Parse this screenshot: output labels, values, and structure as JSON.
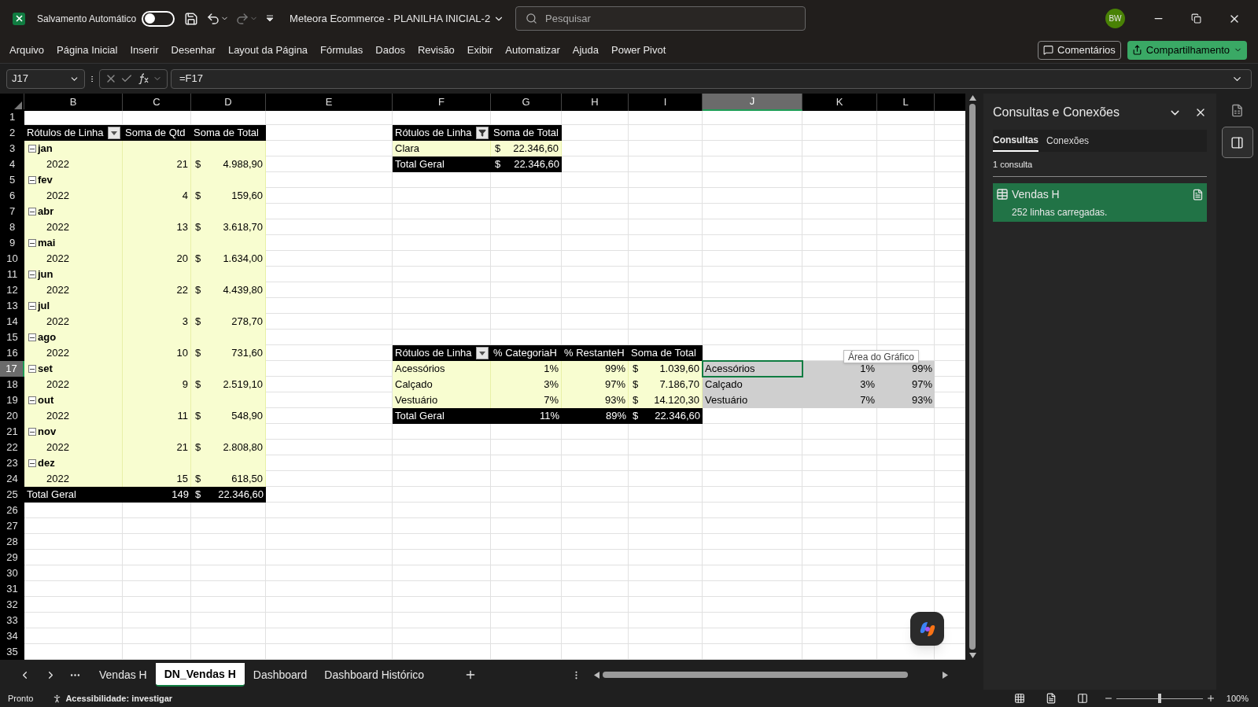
{
  "title_bar": {
    "autosave_label": "Salvamento Automático",
    "autosave_on": false,
    "document_title": "Meteora Ecommerce - PLANILHA INICIAL-2",
    "search_placeholder": "Pesquisar",
    "avatar": "BW"
  },
  "menu": {
    "items": [
      "Arquivo",
      "Página Inicial",
      "Inserir",
      "Desenhar",
      "Layout da Página",
      "Fórmulas",
      "Dados",
      "Revisão",
      "Exibir",
      "Automatizar",
      "Ajuda",
      "Power Pivot"
    ],
    "comments_button": "Comentários",
    "share_button": "Compartilhamento"
  },
  "formula_bar": {
    "name_box": "J17",
    "formula": "=F17"
  },
  "columns": [
    {
      "letter": "B",
      "selected": false
    },
    {
      "letter": "C",
      "selected": false
    },
    {
      "letter": "D",
      "selected": false
    },
    {
      "letter": "E",
      "selected": false
    },
    {
      "letter": "F",
      "selected": false
    },
    {
      "letter": "G",
      "selected": false
    },
    {
      "letter": "H",
      "selected": false
    },
    {
      "letter": "I",
      "selected": false
    },
    {
      "letter": "J",
      "selected": true
    },
    {
      "letter": "K",
      "selected": false
    },
    {
      "letter": "L",
      "selected": false
    }
  ],
  "rows": [
    {
      "number": "1",
      "selected": false,
      "cells": []
    },
    {
      "number": "2",
      "selected": false,
      "cells": [
        {
          "kind": "header",
          "text": "Rótulos de Linha",
          "filtered": false
        },
        {
          "kind": "header",
          "text": "Soma de Qtd"
        },
        {
          "kind": "header",
          "text": "Soma de Total"
        },
        {
          "kind": "blank"
        },
        {
          "kind": "header",
          "text": "Rótulos de Linha",
          "filtered": true
        },
        {
          "kind": "header",
          "text": "Soma de Total"
        }
      ]
    },
    {
      "number": "3",
      "selected": false,
      "cells": [
        {
          "kind": "group",
          "text": "jan",
          "expanded": true
        },
        {
          "kind": "band"
        },
        {
          "kind": "band"
        },
        {
          "kind": "blank"
        },
        {
          "kind": "band",
          "text": "Clara"
        },
        {
          "kind": "band",
          "currency": "$",
          "text": "22.346,60"
        }
      ]
    },
    {
      "number": "4",
      "selected": false,
      "cells": [
        {
          "kind": "item",
          "text": "2022"
        },
        {
          "kind": "value",
          "text": "21"
        },
        {
          "kind": "band",
          "currency": "$",
          "text": "4.988,90"
        },
        {
          "kind": "blank"
        },
        {
          "kind": "total",
          "text": "Total Geral"
        },
        {
          "kind": "total",
          "currency": "$",
          "text": "22.346,60"
        }
      ]
    },
    {
      "number": "5",
      "selected": false,
      "cells": [
        {
          "kind": "group",
          "text": "fev",
          "expanded": true
        },
        {
          "kind": "band"
        },
        {
          "kind": "band"
        }
      ]
    },
    {
      "number": "6",
      "selected": false,
      "cells": [
        {
          "kind": "item",
          "text": "2022"
        },
        {
          "kind": "value",
          "text": "4"
        },
        {
          "kind": "band",
          "currency": "$",
          "text": "159,60"
        }
      ]
    },
    {
      "number": "7",
      "selected": false,
      "cells": [
        {
          "kind": "group",
          "text": "abr",
          "expanded": true
        },
        {
          "kind": "band"
        },
        {
          "kind": "band"
        }
      ]
    },
    {
      "number": "8",
      "selected": false,
      "cells": [
        {
          "kind": "item",
          "text": "2022"
        },
        {
          "kind": "value",
          "text": "13"
        },
        {
          "kind": "band",
          "currency": "$",
          "text": "3.618,70"
        }
      ]
    },
    {
      "number": "9",
      "selected": false,
      "cells": [
        {
          "kind": "group",
          "text": "mai",
          "expanded": true
        },
        {
          "kind": "band"
        },
        {
          "kind": "band"
        }
      ]
    },
    {
      "number": "10",
      "selected": false,
      "cells": [
        {
          "kind": "item",
          "text": "2022"
        },
        {
          "kind": "value",
          "text": "20"
        },
        {
          "kind": "band",
          "currency": "$",
          "text": "1.634,00"
        }
      ]
    },
    {
      "number": "11",
      "selected": false,
      "cells": [
        {
          "kind": "group",
          "text": "jun",
          "expanded": true
        },
        {
          "kind": "band"
        },
        {
          "kind": "band"
        }
      ]
    },
    {
      "number": "12",
      "selected": false,
      "cells": [
        {
          "kind": "item",
          "text": "2022"
        },
        {
          "kind": "value",
          "text": "22"
        },
        {
          "kind": "band",
          "currency": "$",
          "text": "4.439,80"
        }
      ]
    },
    {
      "number": "13",
      "selected": false,
      "cells": [
        {
          "kind": "group",
          "text": "jul",
          "expanded": true
        },
        {
          "kind": "band"
        },
        {
          "kind": "band"
        }
      ]
    },
    {
      "number": "14",
      "selected": false,
      "cells": [
        {
          "kind": "item",
          "text": "2022"
        },
        {
          "kind": "value",
          "text": "3"
        },
        {
          "kind": "band",
          "currency": "$",
          "text": "278,70"
        }
      ]
    },
    {
      "number": "15",
      "selected": false,
      "cells": [
        {
          "kind": "group",
          "text": "ago",
          "expanded": true
        },
        {
          "kind": "band"
        },
        {
          "kind": "band"
        }
      ]
    },
    {
      "number": "16",
      "selected": false,
      "cells": [
        {
          "kind": "item",
          "text": "2022"
        },
        {
          "kind": "value",
          "text": "10"
        },
        {
          "kind": "band",
          "currency": "$",
          "text": "731,60"
        },
        {
          "kind": "blank"
        },
        {
          "kind": "header",
          "text": "Rótulos de Linha",
          "filtered": false
        },
        {
          "kind": "header",
          "text": "% CategoriaH"
        },
        {
          "kind": "header",
          "text": "% RestanteH"
        },
        {
          "kind": "header",
          "text": "Soma de Total"
        }
      ]
    },
    {
      "number": "17",
      "selected": true,
      "cells": [
        {
          "kind": "group",
          "text": "set",
          "expanded": true
        },
        {
          "kind": "band"
        },
        {
          "kind": "band"
        },
        {
          "kind": "blank"
        },
        {
          "kind": "band",
          "text": "Acessórios"
        },
        {
          "kind": "value",
          "text": "1%"
        },
        {
          "kind": "value",
          "text": "99%"
        },
        {
          "kind": "band",
          "currency": "$",
          "text": "1.039,60"
        },
        {
          "kind": "chart",
          "text": "Acessórios"
        },
        {
          "kind": "chart_value",
          "text": "1%"
        },
        {
          "kind": "chart_value",
          "text": "99%"
        }
      ]
    },
    {
      "number": "18",
      "selected": false,
      "cells": [
        {
          "kind": "item",
          "text": "2022"
        },
        {
          "kind": "value",
          "text": "9"
        },
        {
          "kind": "band",
          "currency": "$",
          "text": "2.519,10"
        },
        {
          "kind": "blank"
        },
        {
          "kind": "band",
          "text": "Calçado"
        },
        {
          "kind": "value",
          "text": "3%"
        },
        {
          "kind": "value",
          "text": "97%"
        },
        {
          "kind": "band",
          "currency": "$",
          "text": "7.186,70"
        },
        {
          "kind": "chart",
          "text": "Calçado"
        },
        {
          "kind": "chart_value",
          "text": "3%"
        },
        {
          "kind": "chart_value",
          "text": "97%"
        }
      ]
    },
    {
      "number": "19",
      "selected": false,
      "cells": [
        {
          "kind": "group",
          "text": "out",
          "expanded": true
        },
        {
          "kind": "band"
        },
        {
          "kind": "band"
        },
        {
          "kind": "blank"
        },
        {
          "kind": "band",
          "text": "Vestuário"
        },
        {
          "kind": "value",
          "text": "7%"
        },
        {
          "kind": "value",
          "text": "93%"
        },
        {
          "kind": "band",
          "currency": "$",
          "text": "14.120,30"
        },
        {
          "kind": "chart",
          "text": "Vestuário"
        },
        {
          "kind": "chart_value",
          "text": "7%"
        },
        {
          "kind": "chart_value",
          "text": "93%"
        }
      ]
    },
    {
      "number": "20",
      "selected": false,
      "cells": [
        {
          "kind": "item",
          "text": "2022"
        },
        {
          "kind": "value",
          "text": "11"
        },
        {
          "kind": "band",
          "currency": "$",
          "text": "548,90"
        },
        {
          "kind": "blank"
        },
        {
          "kind": "total",
          "text": "Total Geral"
        },
        {
          "kind": "total_value",
          "text": "11%"
        },
        {
          "kind": "total_value",
          "text": "89%"
        },
        {
          "kind": "total",
          "currency": "$",
          "text": "22.346,60"
        }
      ]
    },
    {
      "number": "21",
      "selected": false,
      "cells": [
        {
          "kind": "group",
          "text": "nov",
          "expanded": true
        },
        {
          "kind": "band"
        },
        {
          "kind": "band"
        }
      ]
    },
    {
      "number": "22",
      "selected": false,
      "cells": [
        {
          "kind": "item",
          "text": "2022"
        },
        {
          "kind": "value",
          "text": "21"
        },
        {
          "kind": "band",
          "currency": "$",
          "text": "2.808,80"
        }
      ]
    },
    {
      "number": "23",
      "selected": false,
      "cells": [
        {
          "kind": "group",
          "text": "dez",
          "expanded": true
        },
        {
          "kind": "band"
        },
        {
          "kind": "band"
        }
      ]
    },
    {
      "number": "24",
      "selected": false,
      "cells": [
        {
          "kind": "item",
          "text": "2022"
        },
        {
          "kind": "value",
          "text": "15"
        },
        {
          "kind": "band",
          "currency": "$",
          "text": "618,50"
        }
      ]
    },
    {
      "number": "25",
      "selected": false,
      "cells": [
        {
          "kind": "total",
          "text": "Total Geral"
        },
        {
          "kind": "total_value",
          "text": "149"
        },
        {
          "kind": "total",
          "currency": "$",
          "text": "22.346,60"
        }
      ]
    },
    {
      "number": "26",
      "selected": false,
      "cells": []
    },
    {
      "number": "27",
      "selected": false,
      "cells": []
    },
    {
      "number": "28",
      "selected": false,
      "cells": []
    },
    {
      "number": "29",
      "selected": false,
      "cells": []
    },
    {
      "number": "30",
      "selected": false,
      "cells": []
    },
    {
      "number": "31",
      "selected": false,
      "cells": []
    },
    {
      "number": "32",
      "selected": false,
      "cells": []
    },
    {
      "number": "33",
      "selected": false,
      "cells": []
    },
    {
      "number": "34",
      "selected": false,
      "cells": []
    },
    {
      "number": "35",
      "selected": false,
      "cells": []
    }
  ],
  "tooltip": "Área do Gráfico",
  "sheet_tabs": [
    {
      "label": "Vendas H",
      "selected": false
    },
    {
      "label": "DN_Vendas H",
      "selected": true
    },
    {
      "label": "Dashboard",
      "selected": false
    },
    {
      "label": "Dashboard Histórico",
      "selected": false
    }
  ],
  "panel": {
    "title": "Consultas e Conexões",
    "tabs": [
      {
        "label": "Consultas",
        "selected": true
      },
      {
        "label": "Conexões",
        "selected": false
      }
    ],
    "count": "1 consulta",
    "queries": [
      {
        "name": "Vendas H",
        "status": "252 linhas carregadas."
      }
    ]
  },
  "status_bar": {
    "status": "Pronto",
    "accessibility": "Acessibilidade: investigar",
    "zoom": "100%",
    "zoom_slider": {
      "level": 0.5
    }
  }
}
